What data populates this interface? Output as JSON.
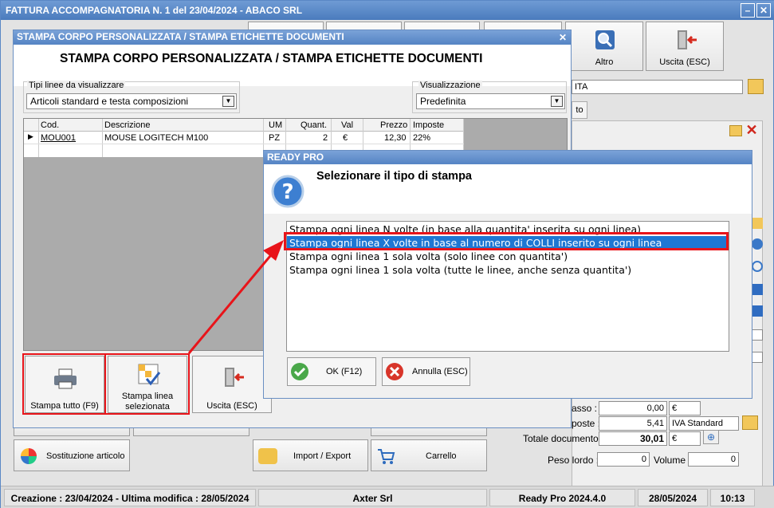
{
  "window": {
    "title": "FATTURA ACCOMPAGNATORIA N. 1 del 23/04/2024 - ABACO SRL",
    "minimize": "–",
    "close": "✕"
  },
  "toolbar": {
    "altro_label": "Altro",
    "uscita_label": "Uscita (ESC)"
  },
  "right_panel": {
    "field_partial": "ITA",
    "tab_partial": "to",
    "incasso_label": "asso :",
    "incasso_value": "0,00",
    "incasso_currency": "€",
    "imposte_label": "poste :",
    "imposte_value": "5,41",
    "imposte_code": "IVA Standard",
    "totale_label": "Totale documento :",
    "totale_value": "30,01",
    "totale_currency": "€",
    "peso_label": "Peso lordo :",
    "peso_value": "0",
    "volume_label": "Volume :",
    "volume_value": "0"
  },
  "bottom_buttons": {
    "sostituzione": "Sostituzione articolo",
    "import_export": "Import / Export",
    "carrello": "Carrello"
  },
  "status": {
    "creation": "Creazione : 23/04/2024 - Ultima modifica : 28/05/2024",
    "company": "Axter Srl",
    "version": "Ready Pro 2024.4.0",
    "date": "28/05/2024",
    "time": "10:13"
  },
  "print_dialog": {
    "title": "STAMPA CORPO PERSONALIZZATA / STAMPA ETICHETTE DOCUMENTI",
    "heading": "STAMPA CORPO PERSONALIZZATA / STAMPA ETICHETTE DOCUMENTI",
    "close": "✕",
    "tipi_label": "Tipi linee da visualizzare",
    "tipi_value": "Articoli standard e testa composizioni",
    "vis_label": "Visualizzazione",
    "vis_value": "Predefinita",
    "columns": [
      "Cod.",
      "Descrizione",
      "UM",
      "Quant.",
      "Val",
      "Prezzo",
      "Imposte"
    ],
    "row": {
      "code": "MOU001",
      "description": "MOUSE LOGITECH M100",
      "um": "PZ",
      "qty": "2",
      "val": "€",
      "price": "12,30",
      "tax": "22%"
    },
    "btn_print_all": "Stampa tutto (F9)",
    "btn_print_line": "Stampa linea selezionata",
    "btn_exit": "Uscita (ESC)"
  },
  "ready_dialog": {
    "title": "READY PRO",
    "prompt": "Selezionare il tipo di stampa",
    "options": [
      "Stampa ogni linea N volte (in base alla quantita' inserita su ogni linea)",
      "Stampa ogni linea X volte in base al numero di COLLI inserito su ogni linea",
      "Stampa ogni linea 1 sola volta (solo linee con quantita')",
      "Stampa ogni linea 1 sola volta (tutte le linee, anche senza quantita')"
    ],
    "selected_index": 1,
    "ok_label": "OK (F12)",
    "cancel_label": "Annulla (ESC)"
  },
  "colors": {
    "highlight": "#1e77d3",
    "annotation": "#e8141a",
    "title_blue": "#4a7bbd"
  }
}
